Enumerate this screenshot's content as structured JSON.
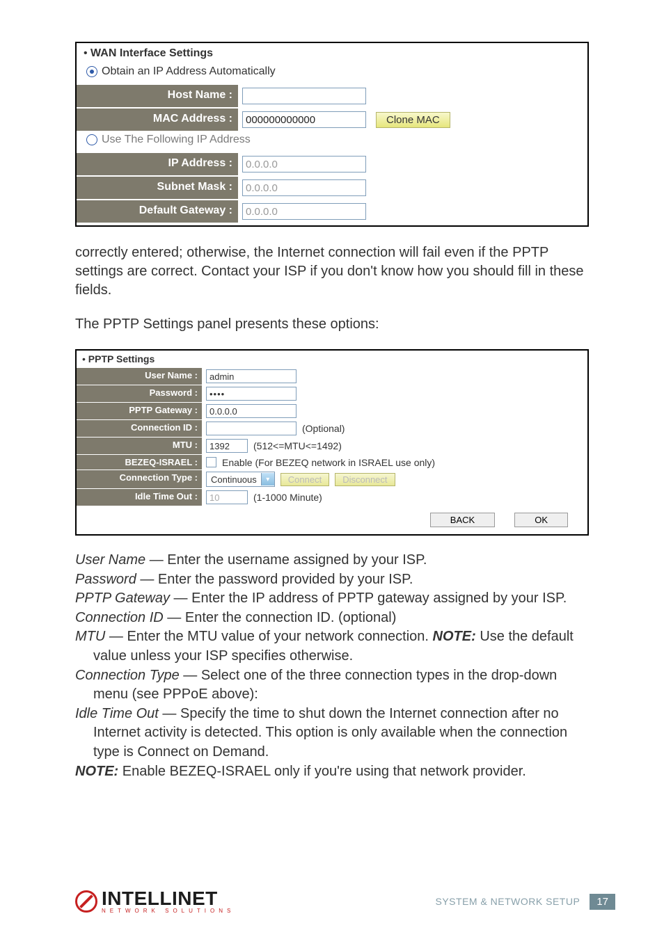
{
  "wan": {
    "title": "WAN Interface Settings",
    "opt_auto": "Obtain an IP Address Automatically",
    "opt_static": "Use The Following IP Address",
    "host_label": "Host Name :",
    "host_value": "",
    "mac_label": "MAC Address :",
    "mac_value": "000000000000",
    "clone_btn": "Clone MAC",
    "ip_label": "IP Address :",
    "ip_value": "0.0.0.0",
    "mask_label": "Subnet Mask :",
    "mask_value": "0.0.0.0",
    "gw_label": "Default Gateway :",
    "gw_value": "0.0.0.0"
  },
  "para1": "correctly entered; otherwise, the Internet connection will fail even if the PPTP settings are correct. Contact your ISP if you don't know how you should fill in these fields.",
  "para2": "The PPTP Settings panel presents these options:",
  "pptp": {
    "title": "PPTP Settings",
    "user_label": "User Name :",
    "user_value": "admin",
    "pass_label": "Password :",
    "pass_value": "••••",
    "gw_label": "PPTP Gateway :",
    "gw_value": "0.0.0.0",
    "cid_label": "Connection ID :",
    "cid_value": "",
    "cid_hint": "(Optional)",
    "mtu_label": "MTU :",
    "mtu_value": "1392",
    "mtu_hint": "(512<=MTU<=1492)",
    "bezeq_label": "BEZEQ-ISRAEL :",
    "bezeq_hint": "Enable (For BEZEQ network in ISRAEL use only)",
    "ctype_label": "Connection Type :",
    "ctype_value": "Continuous",
    "connect_btn": "Connect",
    "disconnect_btn": "Disconnect",
    "idle_label": "Idle Time Out :",
    "idle_value": "10",
    "idle_hint": "(1-1000 Minute)",
    "back_btn": "BACK",
    "ok_btn": "OK"
  },
  "defs": {
    "l1a": "User Name",
    "l1b": " — Enter the username assigned by your ISP.",
    "l2a": "Password",
    "l2b": " — Enter the password provided by your ISP.",
    "l3a": "PPTP Gateway",
    "l3b": " — Enter the IP address of PPTP gateway assigned by your ISP.",
    "l4a": "Connection ID",
    "l4b": " — Enter the connection ID. (optional)",
    "l5a": "MTU",
    "l5b": " — Enter the MTU value of your network connection. ",
    "l5c": "NOTE:",
    "l5d": " Use the default value unless your ISP specifies otherwise.",
    "l6a": "Connection Type",
    "l6b": " — Select one of the three connection types in the drop-down menu (see PPPoE above):",
    "l7a": "Idle Time Out",
    "l7b": " — Specify the time to shut down the Internet connection after no Internet activity is detected. This option is only available when the connection type is Connect on Demand.",
    "l8a": "NOTE:",
    "l8b": " Enable BEZEQ-ISRAEL only if you're using that network provider."
  },
  "footer": {
    "caption": "SYSTEM & NETWORK SETUP",
    "page": "17",
    "logo_main": "INTELLINET",
    "logo_sub": "NETWORK SOLUTIONS"
  }
}
